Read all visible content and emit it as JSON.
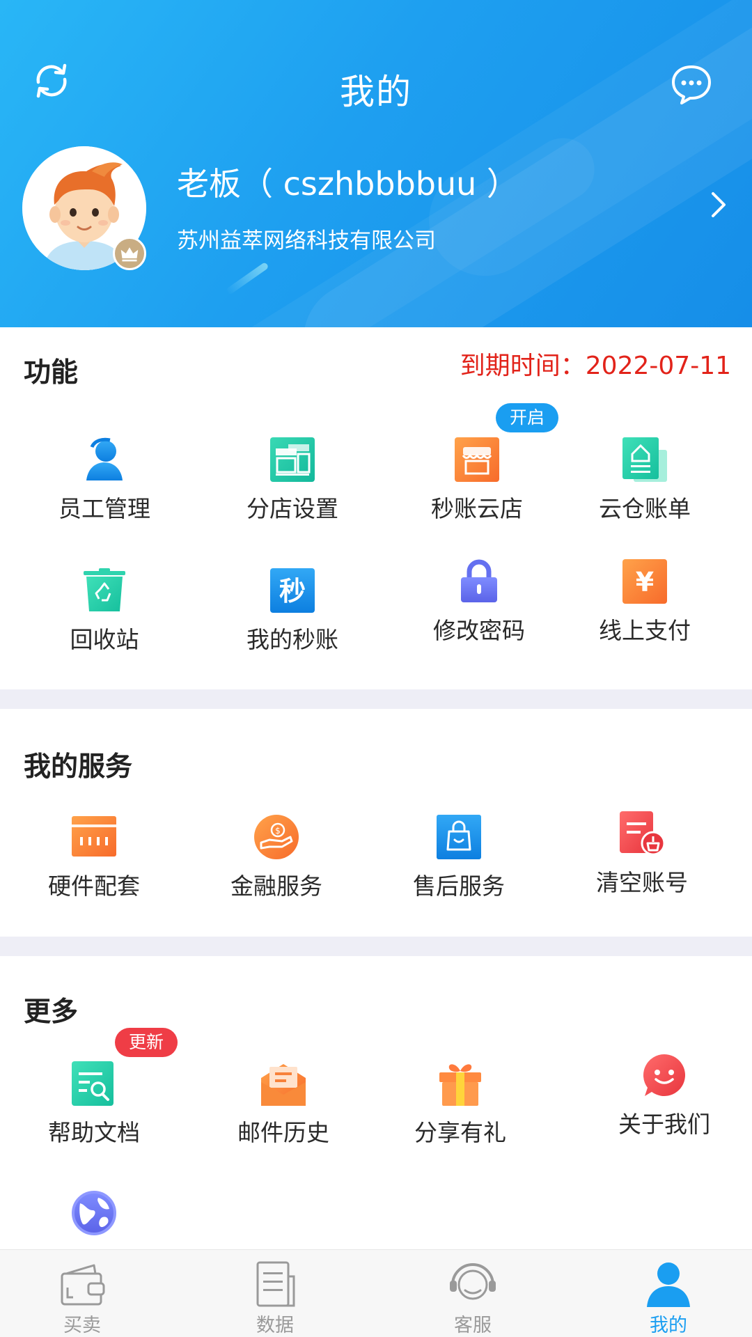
{
  "header": {
    "title": "我的",
    "user_name": "老板（ cszhbbbbuu ）",
    "company": "苏州益萃网络科技有限公司"
  },
  "functions": {
    "title": "功能",
    "expiry_text": "到期时间：2022-07-11",
    "items": [
      {
        "label": "员工管理",
        "icon": "person-icon"
      },
      {
        "label": "分店设置",
        "icon": "store-icon"
      },
      {
        "label": "秒账云店",
        "icon": "shop-icon",
        "badge": "开启"
      },
      {
        "label": "云仓账单",
        "icon": "warehouse-bill-icon"
      },
      {
        "label": "回收站",
        "icon": "recycle-bin-icon"
      },
      {
        "label": "我的秒账",
        "icon": "miaozhang-icon",
        "glyph": "秒"
      },
      {
        "label": "修改密码",
        "icon": "lock-icon"
      },
      {
        "label": "线上支付",
        "icon": "yen-icon",
        "glyph": "¥"
      }
    ]
  },
  "services": {
    "title": "我的服务",
    "items": [
      {
        "label": "硬件配套",
        "icon": "hardware-icon"
      },
      {
        "label": "金融服务",
        "icon": "finance-icon"
      },
      {
        "label": "售后服务",
        "icon": "shopping-bag-icon"
      },
      {
        "label": "清空账号",
        "icon": "clear-account-icon"
      }
    ]
  },
  "more": {
    "title": "更多",
    "items": [
      {
        "label": "帮助文档",
        "icon": "help-doc-icon",
        "badge": "更新"
      },
      {
        "label": "邮件历史",
        "icon": "mail-icon"
      },
      {
        "label": "分享有礼",
        "icon": "gift-icon"
      },
      {
        "label": "关于我们",
        "icon": "smile-chat-icon"
      }
    ],
    "extra_icon": "globe-icon"
  },
  "tabbar": {
    "items": [
      {
        "label": "买卖",
        "icon": "wallet-icon",
        "active": false
      },
      {
        "label": "数据",
        "icon": "document-icon",
        "active": false
      },
      {
        "label": "客服",
        "icon": "headset-icon",
        "active": false
      },
      {
        "label": "我的",
        "icon": "user-icon",
        "active": true
      }
    ]
  },
  "colors": {
    "primary": "#1a9ef1",
    "expiry": "#e2231a",
    "badge_red": "#ef3d46",
    "divider": "#eeeef6"
  }
}
